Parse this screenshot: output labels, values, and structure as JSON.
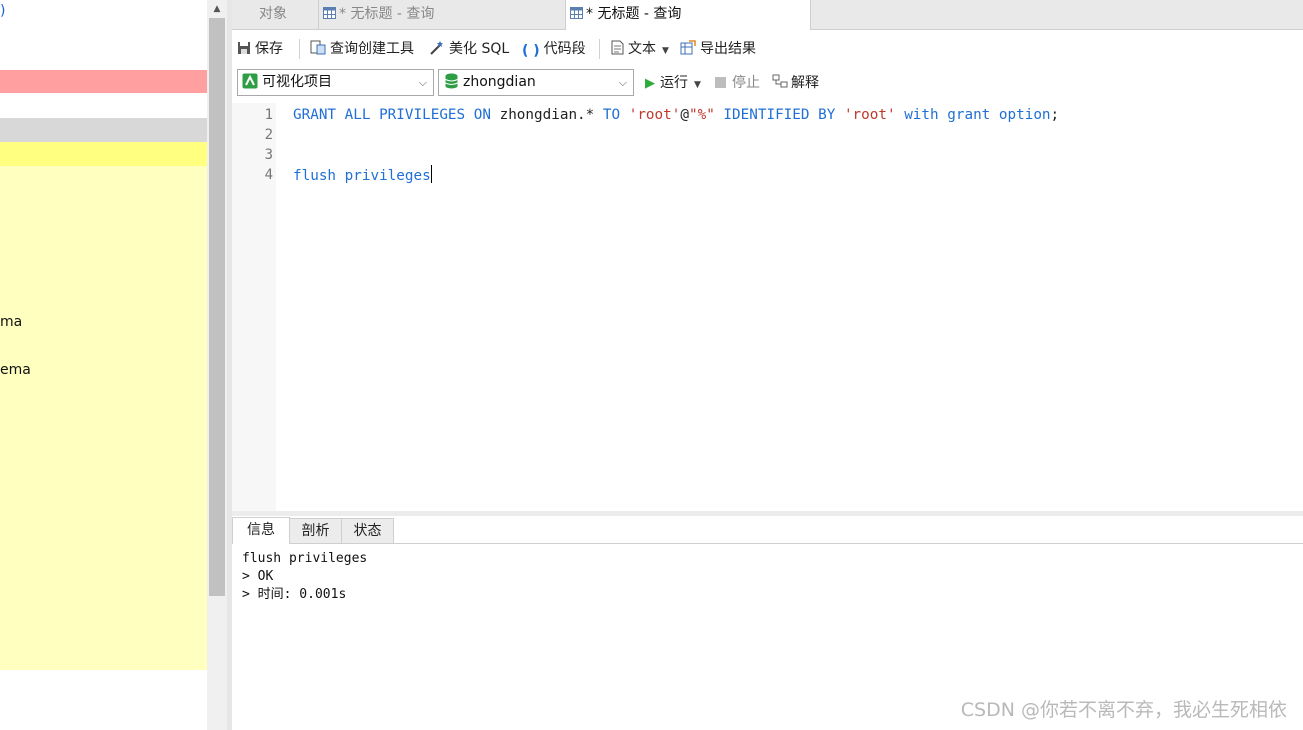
{
  "left_panel": {
    "items": [
      "ma",
      "ema"
    ]
  },
  "tabs": [
    {
      "label": "对象"
    },
    {
      "label": "* 无标题 - 查询"
    },
    {
      "label": "* 无标题 - 查询"
    }
  ],
  "toolbar": {
    "save": "保存",
    "query_builder": "查询创建工具",
    "beautify": "美化 SQL",
    "snippet": "代码段",
    "text": "文本",
    "export": "导出结果"
  },
  "selectors": {
    "connection": "可视化项目",
    "database": "zhongdian"
  },
  "run_bar": {
    "run": "运行",
    "stop": "停止",
    "explain": "解释"
  },
  "editor": {
    "line_numbers": [
      "1",
      "2",
      "3",
      "4"
    ],
    "line1": {
      "t1": "GRANT ALL PRIVILEGES ON",
      "t2": " zhongdian.* ",
      "t3": "TO",
      "t4": " ",
      "t5": "'root'",
      "t6": "@",
      "t7": "\"%\"",
      "t8": " ",
      "t9": "IDENTIFIED BY",
      "t10": " ",
      "t11": "'root'",
      "t12": " ",
      "t13": "with grant option",
      "t14": ";"
    },
    "line4": "flush privileges"
  },
  "result_tabs": [
    "信息",
    "剖析",
    "状态"
  ],
  "output": {
    "lines": [
      "flush privileges",
      "> OK",
      "> 时间: 0.001s"
    ]
  },
  "watermark": "CSDN @你若不离不弃，我必生死相依",
  "colors": {
    "keyword": "#1f6fd6",
    "string": "#c0392b",
    "highlight_pink": "#ff9f9f",
    "highlight_yellow": "#ffffc0"
  }
}
